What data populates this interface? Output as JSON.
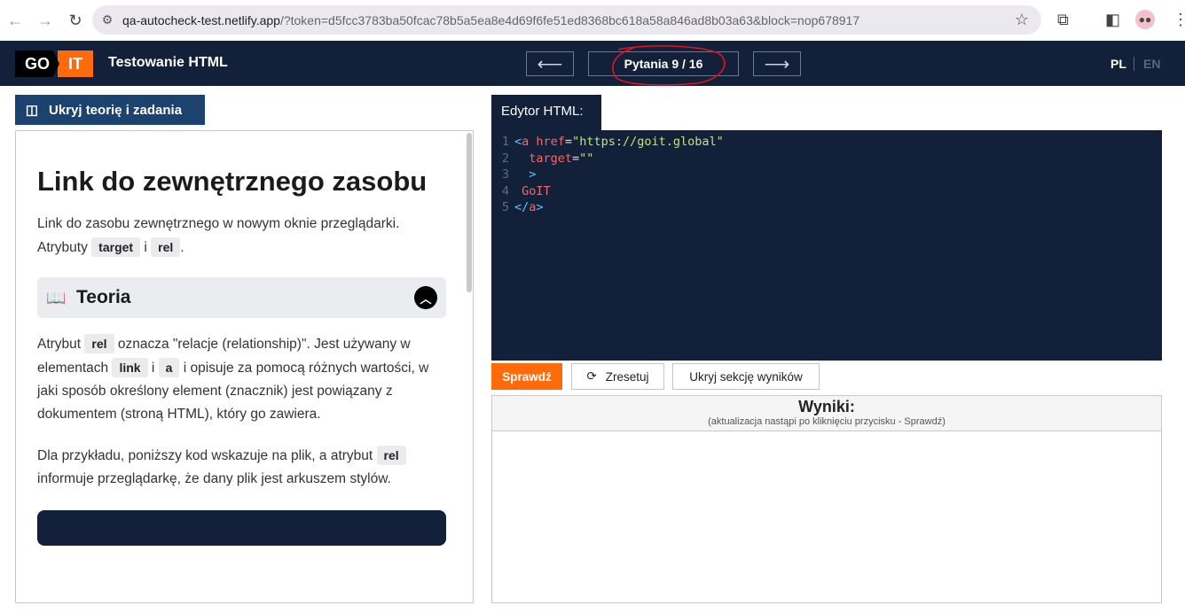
{
  "browser": {
    "url_domain": "qa-autocheck-test.netlify.app",
    "url_rest": "/?token=d5fcc3783ba50fcac78b5a5ea8e4d69f6fe51ed8368bc618a58a846ad8b03a63&block=nop678917"
  },
  "header": {
    "logo_go": "GO",
    "logo_it": "IT",
    "title": "Testowanie HTML",
    "prev": "⟵",
    "question_count": "Pytania 9 / 16",
    "next": "⟶",
    "lang_active": "PL",
    "lang_other": "EN"
  },
  "left": {
    "hide_button": "Ukryj teorię i zadania",
    "title": "Link do zewnętrznego zasobu",
    "intro": {
      "t1": "Link do zasobu zewnętrznego w nowym oknie przeglądarki. Atrybuty ",
      "c1": "target",
      "t2": " i ",
      "c2": "rel",
      "t3": "."
    },
    "section_title": "Teoria",
    "p1": {
      "t1": "Atrybut ",
      "c1": "rel",
      "t2": " oznacza \"relacje (relationship)\". Jest używany w elementach ",
      "c2": "link",
      "t3": " i ",
      "c3": "a",
      "t4": " i opisuje za pomocą różnych wartości, w jaki sposób określony element (znacznik) jest powiązany z dokumentem (stroną HTML), który go zawiera."
    },
    "p2": {
      "t1": "Dla przykładu, poniższy kod wskazuje na plik, a atrybut ",
      "c1": "rel",
      "t2": " informuje przeglądarkę, że dany plik jest arkuszem stylów."
    }
  },
  "editor": {
    "tab": "Edytor HTML:",
    "lines": [
      {
        "n": "1",
        "a": "<",
        "b": "a",
        "c": " href",
        "d": "=",
        "e": "\"https://goit.global\""
      },
      {
        "n": "2",
        "a": "  target",
        "b": "=",
        "c": "\"\""
      },
      {
        "n": "3",
        "a": "  >"
      },
      {
        "n": "4",
        "a": " GoIT"
      },
      {
        "n": "5",
        "a": "</",
        "b": "a",
        "c": ">"
      }
    ]
  },
  "actions": {
    "check": "Sprawdź",
    "reset": "Zresetuj",
    "hide_results": "Ukryj sekcję wyników"
  },
  "results": {
    "title": "Wyniki:",
    "subtitle": "(aktualizacja nastąpi po kliknięciu przycisku - Sprawdź)"
  }
}
